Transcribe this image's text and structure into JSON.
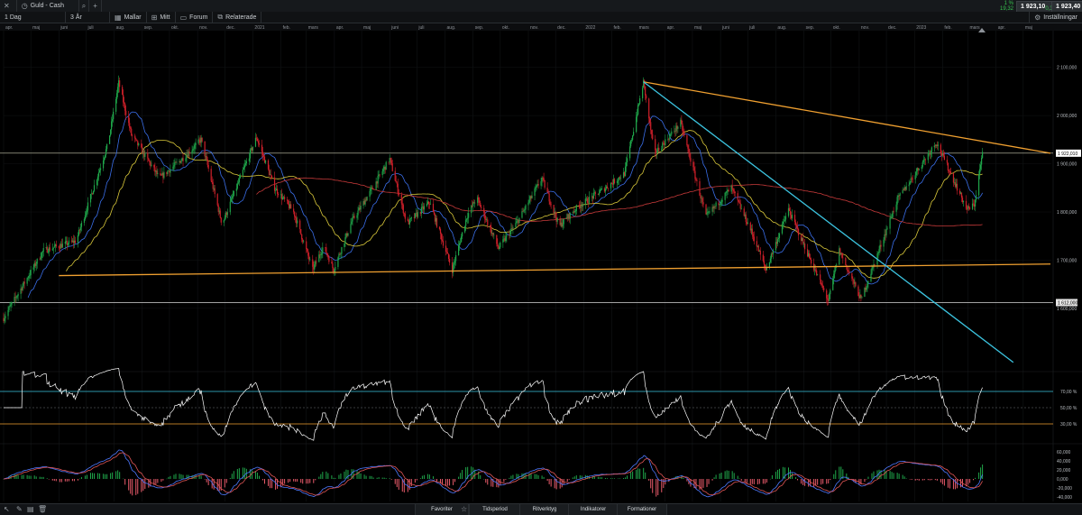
{
  "topbar": {
    "symbol": "Guld - Cash",
    "quote_change_pct": "1 %",
    "quote_change_abs": "19,32",
    "bid": "1 923,10",
    "spread": "0,30",
    "ask": "1 923,40"
  },
  "toolbar": {
    "interval": "1 Dag",
    "range": "3 År",
    "templates": "Mallar",
    "mine": "Mitt",
    "forum": "Forum",
    "related": "Relaterade",
    "settings": "Inställningar"
  },
  "bottombar": {
    "favorites": "Favoriter",
    "period": "Tidsperiod",
    "drawing": "Ritverktyg",
    "indicators": "Indikatorer",
    "patterns": "Formationer"
  },
  "colors": {
    "up": "#1fa64a",
    "down": "#d0202a",
    "trend_orange": "#f0a030",
    "trend_cyan": "#3cc4e0",
    "ma_fast": "#3a6ee8",
    "ma_mid": "#d9c83a",
    "ma_slow": "#c83a3a",
    "rsi_line": "#ffffff",
    "rsi_band": "#3cc4e0",
    "rsi_low": "#f0a030"
  },
  "chart_data": [
    {
      "type": "candlestick",
      "x_ticks": [
        "apr.",
        "maj",
        "juni",
        "juli",
        "aug.",
        "sep.",
        "okt.",
        "nov.",
        "dec.",
        "2021",
        "feb.",
        "mars",
        "apr.",
        "maj",
        "juni",
        "juli",
        "aug.",
        "sep.",
        "okt.",
        "nov.",
        "dec.",
        "2022",
        "feb.",
        "mars",
        "apr.",
        "maj",
        "juni",
        "juli",
        "aug.",
        "sep.",
        "okt.",
        "nov.",
        "dec.",
        "2023",
        "feb.",
        "mars",
        "apr.",
        "maj"
      ],
      "y_ticks": [
        "2 100,000",
        "2 000,000",
        "1 900,000",
        "1 800,000",
        "1 700,000",
        "1 600,000"
      ],
      "ylim": [
        1480,
        2165
      ],
      "current_price_label": "1 922,010",
      "support_label": "1 612,000",
      "horizontal_level": 1922.01,
      "support_level": 1612,
      "trendlines": [
        {
          "name": "resistance",
          "from": [
            "2022-03-08",
            2070
          ],
          "to": [
            "2023-05-31",
            1922
          ]
        },
        {
          "name": "support",
          "from": [
            "2020-06-01",
            1668
          ],
          "to": [
            "2023-05-31",
            1692
          ]
        },
        {
          "name": "down-channel",
          "from": [
            "2022-03-08",
            2070
          ],
          "to": [
            "2023-04-20",
            1488
          ]
        }
      ],
      "key_points": [
        [
          "2020-04-01",
          1580
        ],
        [
          "2020-05-15",
          1720
        ],
        [
          "2020-06-20",
          1740
        ],
        [
          "2020-07-25",
          1940
        ],
        [
          "2020-08-06",
          2068
        ],
        [
          "2020-08-20",
          1960
        ],
        [
          "2020-09-20",
          1870
        ],
        [
          "2020-10-15",
          1910
        ],
        [
          "2020-11-05",
          1950
        ],
        [
          "2020-11-28",
          1775
        ],
        [
          "2020-12-20",
          1880
        ],
        [
          "2021-01-05",
          1955
        ],
        [
          "2021-01-25",
          1850
        ],
        [
          "2021-02-15",
          1800
        ],
        [
          "2021-03-08",
          1680
        ],
        [
          "2021-03-20",
          1730
        ],
        [
          "2021-03-31",
          1680
        ],
        [
          "2021-04-20",
          1780
        ],
        [
          "2021-05-10",
          1840
        ],
        [
          "2021-06-01",
          1910
        ],
        [
          "2021-06-20",
          1775
        ],
        [
          "2021-07-15",
          1820
        ],
        [
          "2021-08-09",
          1680
        ],
        [
          "2021-08-25",
          1790
        ],
        [
          "2021-09-05",
          1830
        ],
        [
          "2021-09-29",
          1725
        ],
        [
          "2021-10-20",
          1780
        ],
        [
          "2021-11-16",
          1870
        ],
        [
          "2021-12-05",
          1770
        ],
        [
          "2021-12-25",
          1810
        ],
        [
          "2022-01-25",
          1850
        ],
        [
          "2022-02-15",
          1880
        ],
        [
          "2022-03-08",
          2070
        ],
        [
          "2022-03-20",
          1920
        ],
        [
          "2022-04-18",
          1985
        ],
        [
          "2022-05-16",
          1790
        ],
        [
          "2022-06-13",
          1850
        ],
        [
          "2022-07-05",
          1760
        ],
        [
          "2022-07-21",
          1680
        ],
        [
          "2022-08-15",
          1805
        ],
        [
          "2022-09-28",
          1615
        ],
        [
          "2022-10-10",
          1720
        ],
        [
          "2022-11-03",
          1618
        ],
        [
          "2022-12-13",
          1825
        ],
        [
          "2023-01-25",
          1945
        ],
        [
          "2023-02-28",
          1805
        ],
        [
          "2023-03-08",
          1815
        ],
        [
          "2023-03-17",
          1922
        ]
      ]
    },
    {
      "type": "line",
      "name": "RSI",
      "y_ticks": [
        "70,00 %",
        "50,00 %",
        "30,00 %"
      ],
      "ylim": [
        10,
        90
      ],
      "upper": 70,
      "lower": 30,
      "mid": 50
    },
    {
      "type": "bar",
      "name": "MACD",
      "y_ticks": [
        "60,000",
        "40,000",
        "20,000",
        "0,000",
        "-20,000",
        "-40,000"
      ],
      "ylim": [
        -50,
        70
      ]
    }
  ]
}
